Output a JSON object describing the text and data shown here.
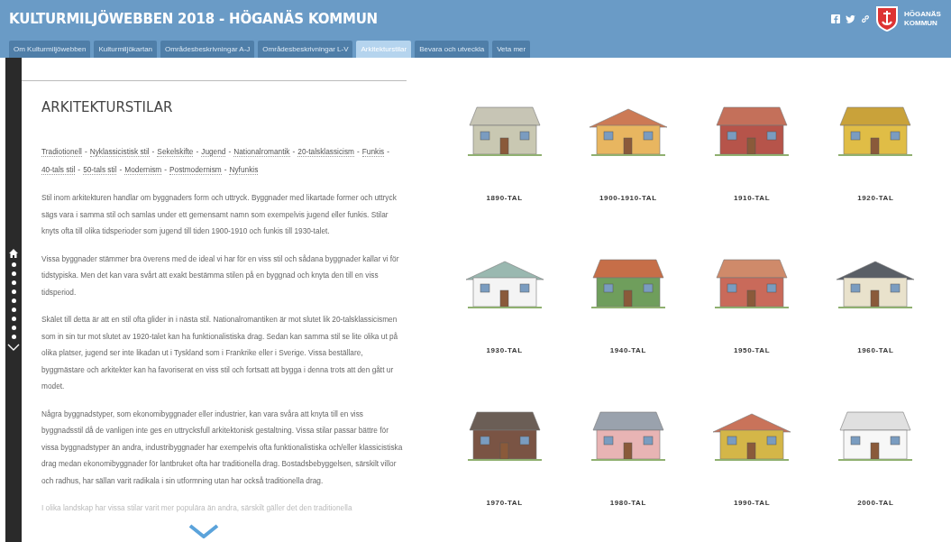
{
  "header": {
    "title": "KULTURMILJÖWEBBEN 2018 - HÖGANÄS KOMMUN",
    "logo_text": "HÖGANÄS KOMMUN"
  },
  "tabs": [
    {
      "label": "Om Kulturmiljöwebben",
      "selected": false
    },
    {
      "label": "Kulturmiljökartan",
      "selected": false
    },
    {
      "label": "Områdesbeskrivningar A-J",
      "selected": false
    },
    {
      "label": "Områdesbeskrivningar L-V",
      "selected": false
    },
    {
      "label": "Arkitekturstilar",
      "selected": true
    },
    {
      "label": "Bevara och utveckla",
      "selected": false
    },
    {
      "label": "Veta mer",
      "selected": false
    }
  ],
  "article": {
    "heading": "ARKITEKTURSTILAR",
    "link_separator": "-",
    "style_links": [
      "Tradiotionell",
      "Nyklassicistisk stil",
      "Sekelskifte",
      "Jugend",
      "Nationalromantik",
      "20-talsklassicism",
      "Funkis",
      "40-tals stil",
      "50-tals stil",
      "Modernism",
      "Postmodernism",
      "Nyfunkis"
    ],
    "paragraphs": [
      "Stil inom arkitekturen handlar om byggnaders form och uttryck. Byggnader med likartade former och uttryck sägs vara i samma stil och samlas under ett gemensamt namn som exempelvis jugend eller funkis. Stilar knyts ofta till olika tidsperioder som jugend till tiden 1900-1910 och funkis till 1930-talet.",
      "Vissa byggnader stämmer bra överens med de ideal vi har för en viss stil och sådana byggnader kallar vi för tidstypiska. Men det kan vara svårt att exakt bestämma stilen på en byggnad och knyta den till en viss tidsperiod.",
      "Skälet till detta är att en stil ofta glider in i nästa stil. Nationalromantiken är mot slutet lik 20-talsklassicismen som in sin tur mot slutet av 1920-talet kan ha funktionalistiska drag. Sedan kan samma stil se lite olika ut på olika platser, jugend ser inte likadan ut i Tyskland som i Frankrike eller i Sverige. Vissa beställare, byggmästare och arkitekter kan ha favoriserat en viss stil och fortsatt att bygga i denna trots att den gått ur modet.",
      "Några byggnadstyper, som ekonomibyggnader eller industrier, kan vara svåra att knyta till en viss byggnadsstil då de vanligen inte ges en uttrycksfull arkitektonisk gestaltning. Vissa stilar passar bättre för vissa byggnadstyper än andra, industribyggnader har exempelvis ofta funktionalistiska och/eller klassicistiska drag medan ekonomibyggnader för lantbruket ofta har traditionella drag. Bostadsbebyggelsen, särskilt villor och radhus, har sällan varit radikala i sin utformning utan har också traditionella drag."
    ],
    "faded_line": "I olika landskap har vissa stilar varit mer populära än andra, särskilt gäller det den traditionella"
  },
  "periods": [
    "1890-TAL",
    "1900-1910-TAL",
    "1910-TAL",
    "1920-TAL",
    "1930-TAL",
    "1940-TAL",
    "1950-TAL",
    "1960-TAL",
    "1970-TAL",
    "1980-TAL",
    "1990-TAL",
    "2000-TAL"
  ]
}
